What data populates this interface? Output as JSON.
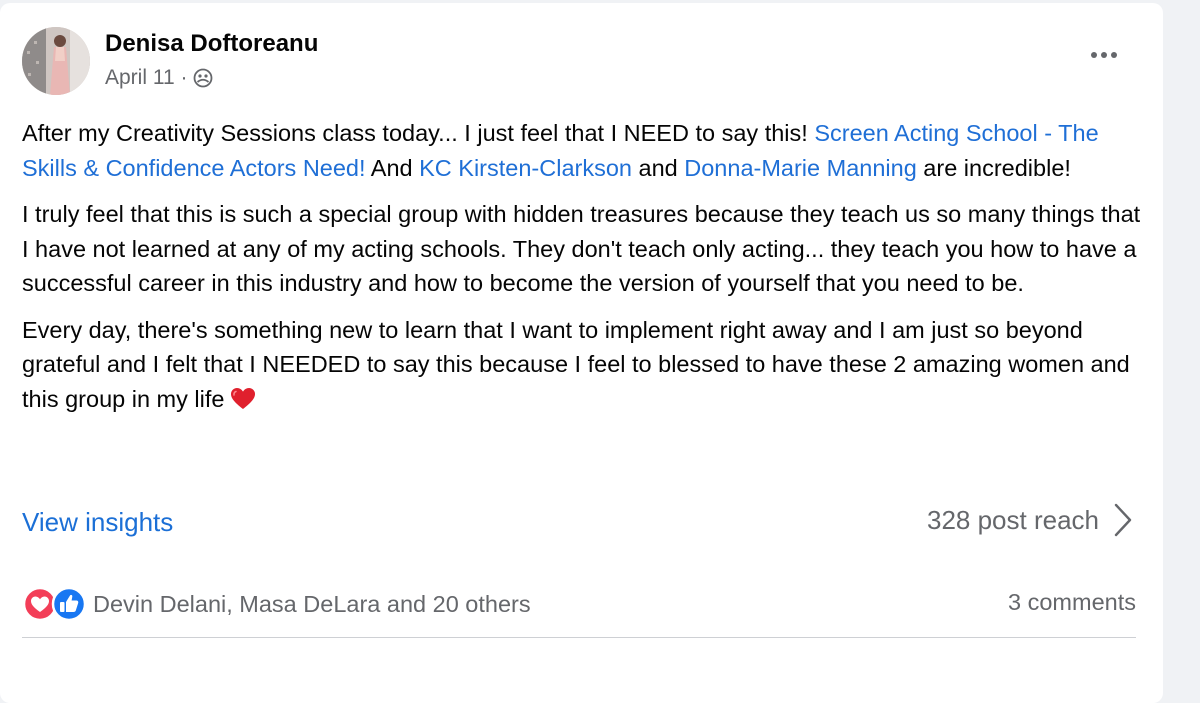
{
  "post": {
    "author": "Denisa Doftoreanu",
    "date": "April 11 ·",
    "audience_icon": "group-audience-icon",
    "more_icon": "more-options-icon",
    "paragraph1": {
      "text1": "After my Creativity Sessions class today... I just feel that I NEED to say this! ",
      "link1": "Screen Acting School - The Skills & Confidence Actors Need!",
      "text2": " And ",
      "link2": "KC Kirsten-Clarkson",
      "text3": " and ",
      "link3": "Donna-Marie Manning",
      "text4": " are incredible!"
    },
    "paragraph2": "I truly feel that this is such a special group with hidden treasures because they teach us so many things that I have not learned at any of my acting schools. They don't teach only acting... they teach you how to have a successful career in this industry and how to become the version of yourself that you need to be.",
    "paragraph3": "Every day, there's something new to learn that I want to implement right away and I am just so beyond grateful and I felt that I NEEDED to say this because I feel to blessed to have these 2 amazing women and this group in my life"
  },
  "footer": {
    "insights_label": "View insights",
    "reach_label": "328 post reach",
    "reactions_label": "Devin Delani, Masa DeLara and 20 others",
    "comments_label": "3 comments"
  },
  "colors": {
    "link": "#1f6fd6",
    "muted": "#65676b",
    "love": "#f33e58",
    "like": "#1877f2"
  }
}
